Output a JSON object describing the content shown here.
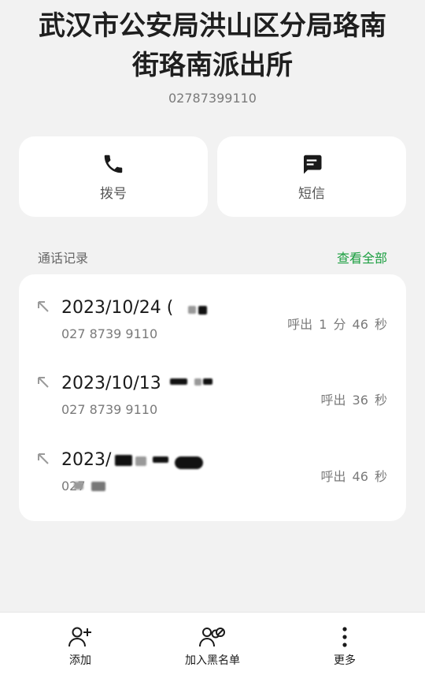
{
  "contact": {
    "title_line1": "武汉市公安局洪山区分局珞南",
    "title_line2": "街珞南派出所",
    "number": "02787399110"
  },
  "actions": {
    "dial_label": "拨号",
    "sms_label": "短信"
  },
  "call_log": {
    "section_title": "通话记录",
    "view_all": "查看全部",
    "entries": [
      {
        "date": "2023/10/24 (",
        "phone": "027 8739 9110",
        "duration": "呼出 1 分 46 秒"
      },
      {
        "date": "2023/10/13",
        "phone": "027 8739 9110",
        "duration": "呼出 36 秒"
      },
      {
        "date": "2023/",
        "phone": "027",
        "duration": "呼出 46 秒"
      }
    ]
  },
  "bottom_bar": {
    "add_label": "添加",
    "block_label": "加入黑名单",
    "more_label": "更多"
  },
  "colors": {
    "accent_green": "#1a9e3f",
    "background": "#f2f2f2"
  }
}
